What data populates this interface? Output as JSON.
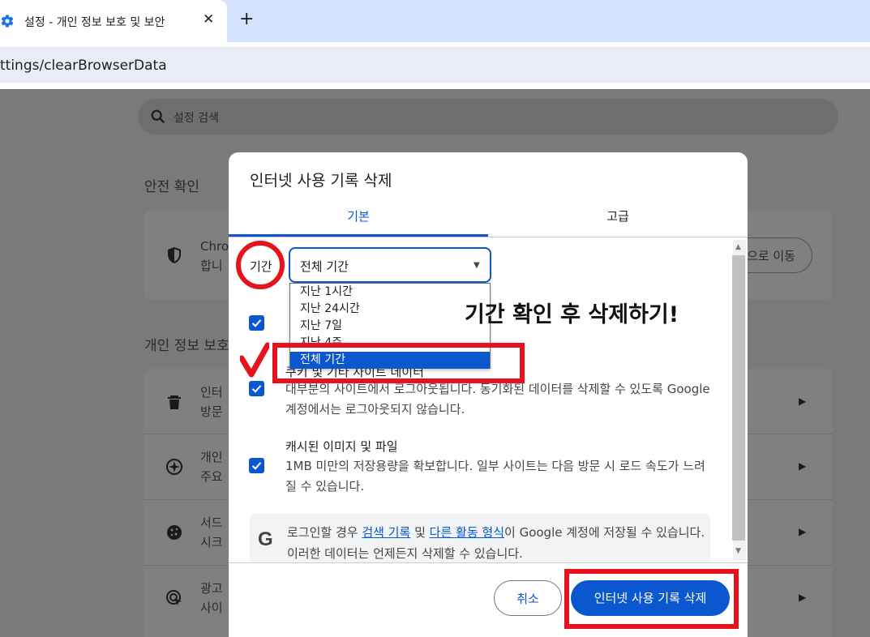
{
  "browser": {
    "tab_title": "설정 - 개인 정보 보호 및 보안",
    "tab_close": "✕",
    "new_tab": "+",
    "url": "ttings/clearBrowserData"
  },
  "page": {
    "search_placeholder": "설정 검색",
    "safety_title": "안전 확인",
    "safety_text_1": "Chro",
    "safety_text_2": "합니",
    "go_button": "으로 이동",
    "privacy_title": "개인 정보 보호",
    "rows": [
      {
        "line1": "인터",
        "line2": "방문",
        "icon": "trash-icon"
      },
      {
        "line1": "개인",
        "line2": "주요",
        "icon": "compass-icon"
      },
      {
        "line1": "서드",
        "line2": "시크",
        "icon": "cookie-icon"
      },
      {
        "line1": "광고",
        "line2": "사이",
        "icon": "ad-target-icon"
      }
    ]
  },
  "dialog": {
    "title": "인터넷 사용 기록 삭제",
    "tab_basic": "기본",
    "tab_advanced": "고급",
    "period_label": "기간",
    "selected_period": "전체 기간",
    "period_options": [
      "지난 1시간",
      "지난 24시간",
      "지난 7일",
      "지난 4주",
      "전체 기간"
    ],
    "items": [
      {
        "title": "",
        "desc": "",
        "checked": true
      },
      {
        "title": "쿠키 및 기타 사이트 데이터",
        "desc": "대부분의 사이트에서 로그아웃됩니다. 동기화된 데이터를 삭제할 수 있도록 Google 계정에서는 로그아웃되지 않습니다.",
        "checked": true
      },
      {
        "title": "캐시된 이미지 및 파일",
        "desc": "1MB 미만의 저장용량을 확보합니다. 일부 사이트는 다음 방문 시 로드 속도가 느려질 수 있습니다.",
        "checked": true
      }
    ],
    "notice": {
      "prefix": "로그인할 경우 ",
      "link1": "검색 기록",
      "mid": " 및 ",
      "link2": "다른 활동 형식",
      "suffix": "이 Google 계정에 저장될 수 있습니다. 이러한 데이터는 언제든지 삭제할 수 있습니다."
    },
    "cancel_label": "취소",
    "delete_label": "인터넷 사용 기록 삭제"
  },
  "annotation": {
    "text": "기간 확인 후 삭제하기!",
    "color": "#e8121d"
  },
  "colors": {
    "accent": "#0b57d0",
    "overlay": "#7a7a7a"
  }
}
